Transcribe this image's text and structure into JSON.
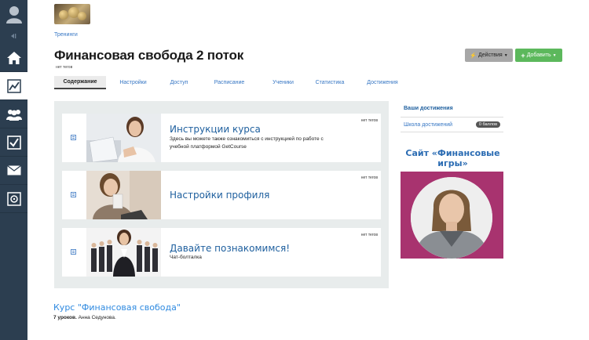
{
  "breadcrumb": "Тренинги",
  "page": {
    "title": "Финансовая свобода 2 поток",
    "tags": "нет тегов"
  },
  "toolbar": {
    "actions_label": "Действия",
    "add_label": "Добавить"
  },
  "tabs": [
    {
      "label": "Содержание",
      "active": true
    },
    {
      "label": "Настройки"
    },
    {
      "label": "Доступ"
    },
    {
      "label": "Расписание"
    },
    {
      "label": "Ученики"
    },
    {
      "label": "Статистика"
    },
    {
      "label": "Достижения"
    }
  ],
  "lessons": [
    {
      "title": "Инструкции курса",
      "description": "Здесь вы можете также ознакомиться с инструкцией по работе с учебной платформой GetCourse",
      "tags": "нет тегов"
    },
    {
      "title": "Настройки профиля",
      "description": "",
      "tags": "нет тегов"
    },
    {
      "title": "Давайте познакомимся!",
      "description": "Чат-болталка",
      "tags": "нет тегов"
    }
  ],
  "achievements": {
    "title": "Ваши достижения",
    "school_label": "Школа достижений",
    "points_badge": "0 баллов"
  },
  "promo": {
    "title": "Сайт «Финансовые игры»"
  },
  "course": {
    "link": "Курс \"Финансовая свобода\"",
    "lessons_count": "7 уроков.",
    "author": "Анна Седунова."
  },
  "sidebar": {
    "items": [
      "home-icon",
      "chart-icon",
      "users-icon",
      "checkbox-icon",
      "mail-icon",
      "safe-icon"
    ],
    "active": "chart-icon"
  },
  "colors": {
    "sidebar": "#2c3e50",
    "accent": "#3777c4",
    "add_button": "#5cb85c",
    "promo_bg": "#a8336f"
  }
}
